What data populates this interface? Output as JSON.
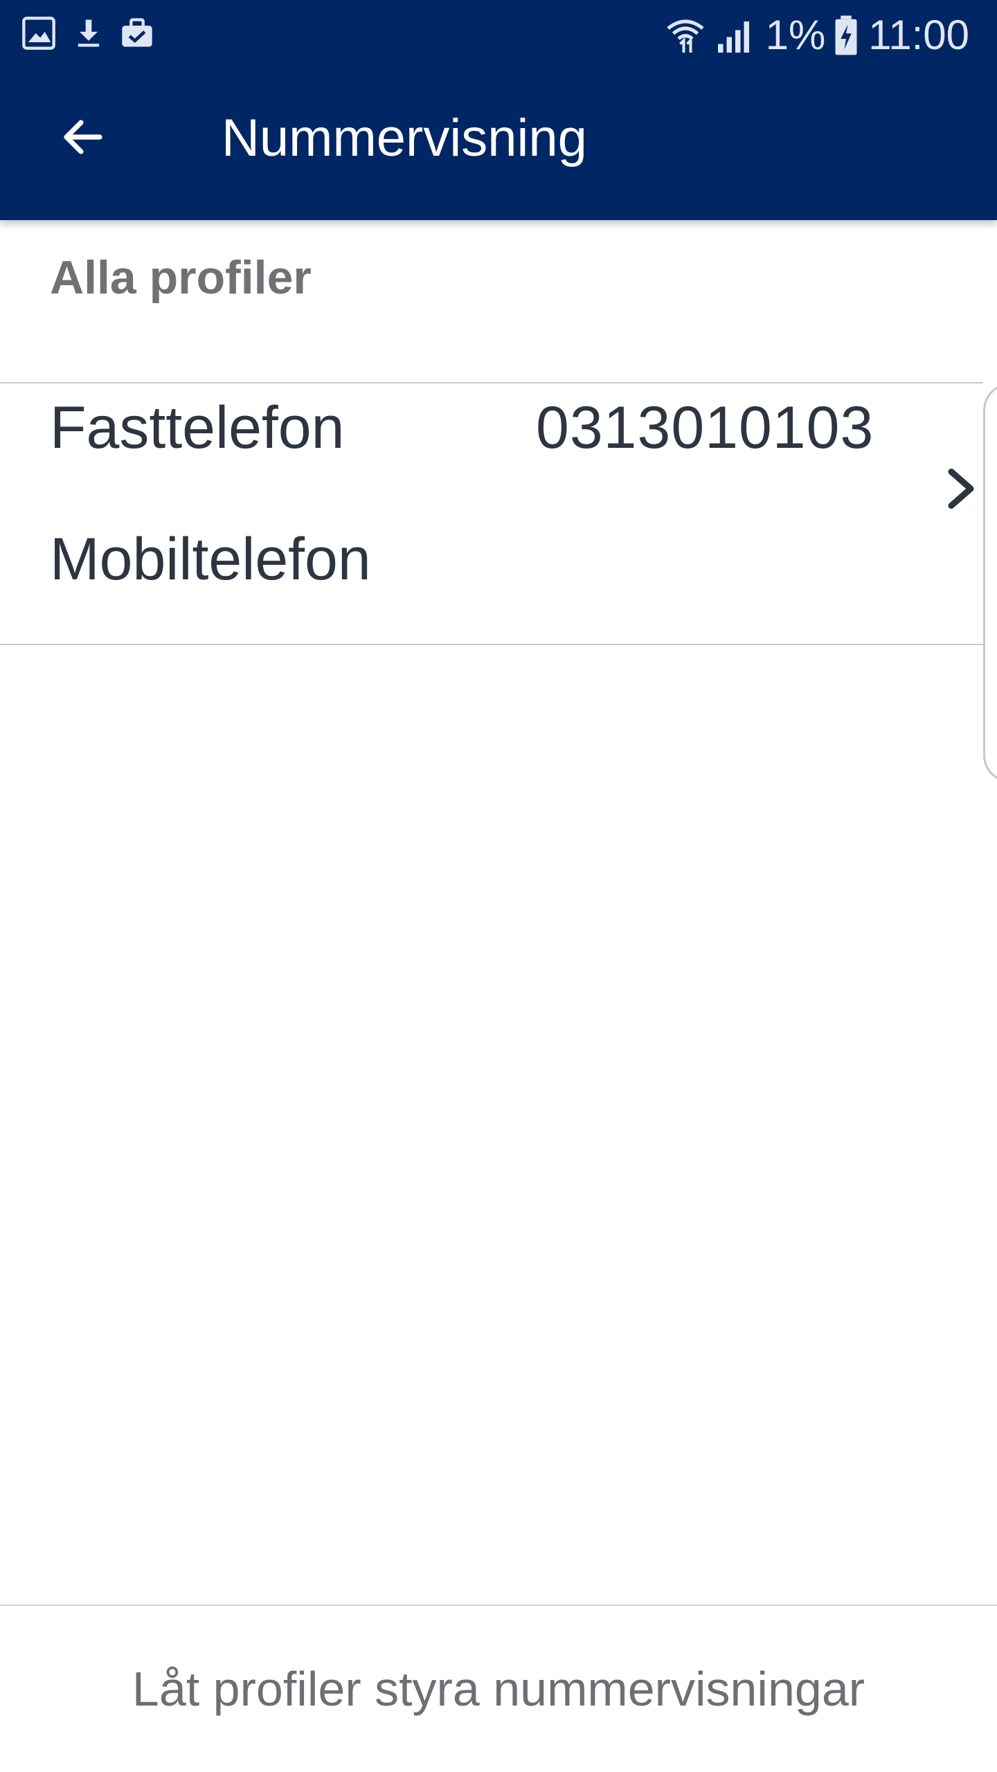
{
  "statusbar": {
    "left_icons": [
      "gallery-icon",
      "download-icon",
      "briefcase-check-icon"
    ],
    "battery_percent": "1%",
    "time": "11:00"
  },
  "toolbar": {
    "title": "Nummervisning",
    "back_icon": "arrow-left-icon"
  },
  "section": {
    "title": "Alla profiler"
  },
  "profile": {
    "rows": [
      {
        "label": "Fasttelefon",
        "value": "0313010103"
      },
      {
        "label": "Mobiltelefon",
        "value": ""
      }
    ]
  },
  "bottom": {
    "label": "Låt profiler styra nummervisningar"
  },
  "colors": {
    "appbar": "#002664",
    "text": "#2e3440",
    "muted": "#6f7174"
  }
}
